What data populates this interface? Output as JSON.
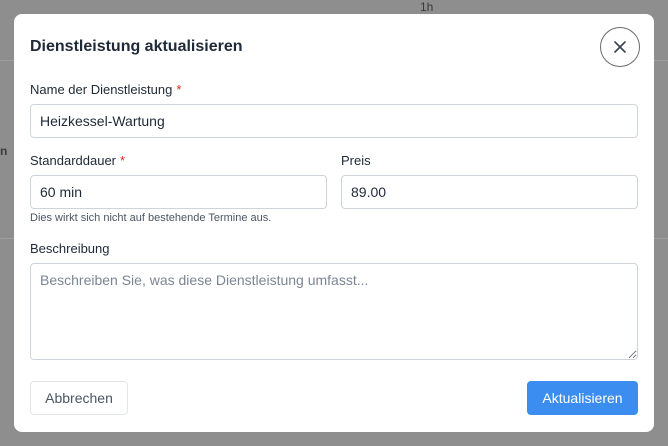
{
  "background": {
    "top_label": "1h",
    "left_fragment": "n"
  },
  "dialog": {
    "title": "Dienstleistung aktualisieren",
    "close_icon": "close-icon",
    "fields": {
      "name": {
        "label": "Name der Dienstleistung",
        "required_mark": "*",
        "value": "Heizkessel-Wartung"
      },
      "duration": {
        "label": "Standarddauer",
        "required_mark": "*",
        "value": "60 min",
        "hint": "Dies wirkt sich nicht auf bestehende Termine aus."
      },
      "price": {
        "label": "Preis",
        "value": "89.00"
      },
      "description": {
        "label": "Beschreibung",
        "placeholder": "Beschreiben Sie, was diese Dienstleistung umfasst..."
      }
    },
    "buttons": {
      "cancel": "Abbrechen",
      "submit": "Aktualisieren"
    }
  },
  "colors": {
    "primary": "#3b8ef0",
    "required": "#dc2626",
    "overlay": "#8e8e8e"
  }
}
